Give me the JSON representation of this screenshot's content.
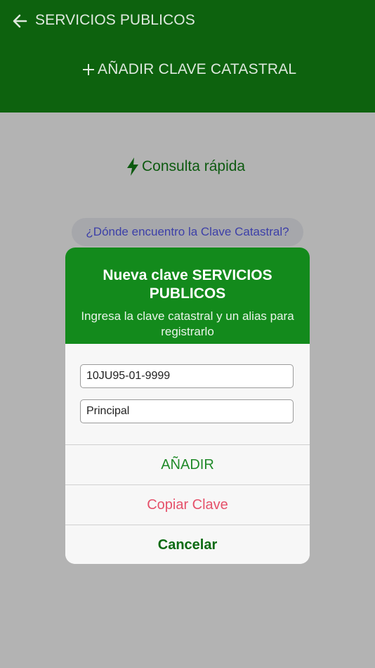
{
  "header": {
    "title": "SERVICIOS PUBLICOS",
    "add_key_label": "AÑADIR CLAVE CATASTRAL",
    "back_icon": "arrow-left-icon",
    "plus_icon": "plus-icon"
  },
  "content": {
    "quick_query_label": "Consulta rápida",
    "quick_query_icon": "bolt-icon",
    "where_find_label": "¿Dónde encuentro la Clave Catastral?"
  },
  "dialog": {
    "title": "Nueva clave SERVICIOS PUBLICOS",
    "subtitle": "Ingresa la clave catastral y un alias para registrarlo",
    "key_value": "10JU95-01-9999",
    "alias_value": "Principal",
    "add_label": "AÑADIR",
    "copy_label": "Copiar Clave",
    "cancel_label": "Cancelar"
  },
  "colors": {
    "header_bg": "#0d620e",
    "dialog_header_bg": "#138a1c",
    "overlay_bg": "#b3b3b3",
    "add_text": "#1f8a28",
    "copy_text": "#e5516a",
    "cancel_text": "#0b6a12",
    "link_text": "#3c3fa8"
  }
}
